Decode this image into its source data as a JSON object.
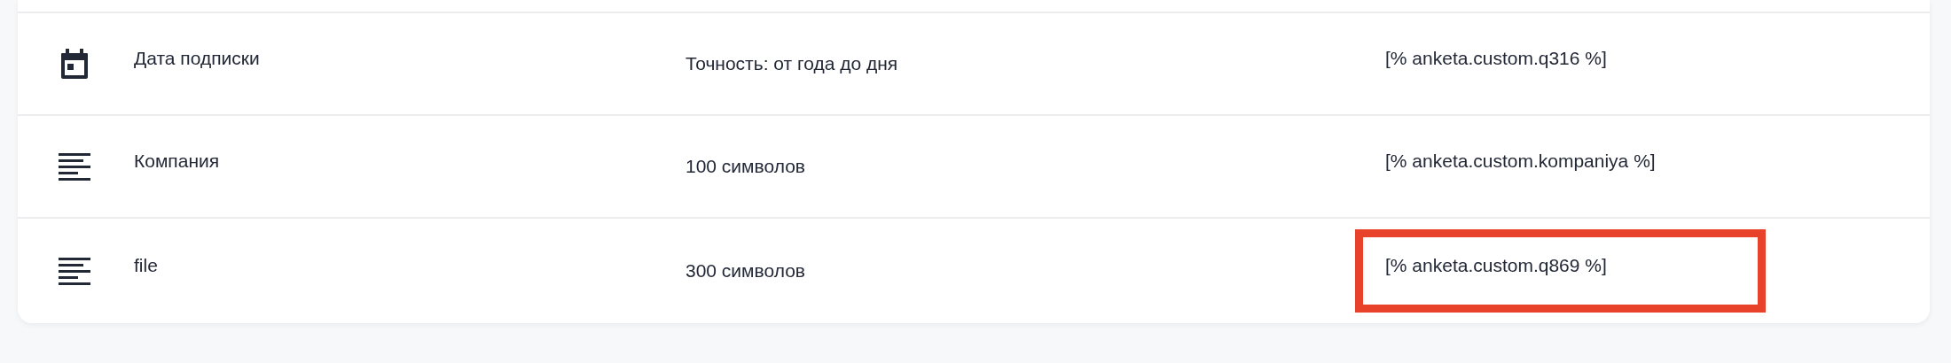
{
  "fields": [
    {
      "kind": "date",
      "name": "Дата подписки",
      "constraint": "Точность: от года до дня",
      "variable": "[% anketa.custom.q316 %]",
      "highlighted": false
    },
    {
      "kind": "text",
      "name": "Компания",
      "constraint": "100 символов",
      "variable": "[% anketa.custom.kompaniya %]",
      "highlighted": false
    },
    {
      "kind": "text",
      "name": "file",
      "constraint": "300 символов",
      "variable": "[% anketa.custom.q869 %]",
      "highlighted": true
    }
  ]
}
